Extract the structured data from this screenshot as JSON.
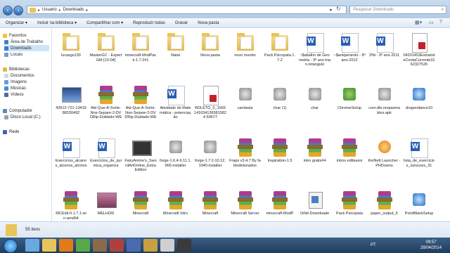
{
  "address": {
    "crumbs": [
      "Usuario",
      "Downloads"
    ],
    "search_placeholder": "Pesquisar Downloads"
  },
  "toolbar": {
    "organize": "Organizar",
    "include": "Incluir na biblioteca",
    "share": "Compartilhar com",
    "play": "Reproduzir todas",
    "burn": "Gravar",
    "new_folder": "Nova pasta"
  },
  "sidebar": {
    "favorites": "Favoritos",
    "desktop": "Área de Trabalho",
    "downloads": "Downloads",
    "places": "Locais",
    "libraries": "Bibliotecas",
    "documents": "Documentos",
    "images": "Imagens",
    "music": "Músicas",
    "videos": "Vídeos",
    "computer": "Computador",
    "disk": "Disco Local (C:)",
    "network": "Rede"
  },
  "files": [
    {
      "name": "lucasgs130",
      "type": "folder"
    },
    {
      "name": "MasterGC - ExpertGM [10-04]",
      "type": "folder"
    },
    {
      "name": "minecraft-ModPack-1.7.2#1",
      "type": "folder"
    },
    {
      "name": "Natal",
      "type": "folder"
    },
    {
      "name": "Nova pasta",
      "type": "folder"
    },
    {
      "name": "novo mundo",
      "type": "folder"
    },
    {
      "name": "Pack Psicopata 1.7.2",
      "type": "folder"
    },
    {
      "name": "~$abalho de Geometria - 9º ano trian.retangulo",
      "type": "doc"
    },
    {
      "name": "~$anejamento - 9ºano-2012",
      "type": "doc"
    },
    {
      "name": "3ºbi - 9º ano 2011",
      "type": "doc"
    },
    {
      "name": "04201453ExtratodeContaCorrente3162327526",
      "type": "pdf"
    },
    {
      "name": "43912-721-1341986530492",
      "type": "img"
    },
    {
      "name": "Até-Que-A-Sorte-Nos-Separe-2-DVDRip-Dublado-WELLINGTON-...",
      "type": "rar"
    },
    {
      "name": "Até-Que-A-Sorte-Nos-Separe-2-DVDRip-Dublado-WELLINGTON-...",
      "type": "rar"
    },
    {
      "name": "Atividade de Matemática - potenciação",
      "type": "doc"
    },
    {
      "name": "BOLETO_0_19031416341365815824 60677",
      "type": "pdf"
    },
    {
      "name": "camtasia",
      "type": "app2"
    },
    {
      "name": "char (1)",
      "type": "app2"
    },
    {
      "name": "char",
      "type": "app2"
    },
    {
      "name": "ChromeSetup",
      "type": "app"
    },
    {
      "name": "com.dle.respawnables.apk",
      "type": "app2"
    },
    {
      "name": "dragondance10",
      "type": "blue"
    },
    {
      "name": "Exercicios_alcanos_alcenos_alcinos",
      "type": "doc"
    },
    {
      "name": "Exercicios_de_quimica_organica",
      "type": "doc"
    },
    {
      "name": "FairyAnime's_SwordArtOnline_ExtraEdition",
      "type": "video"
    },
    {
      "name": "forge-1.6.4-9.11.1.965-installer",
      "type": "app2"
    },
    {
      "name": "forge-1.7.2-10.12.1040-installer",
      "type": "app2"
    },
    {
      "name": "Fraps v3.4.7 By fabiodetonados",
      "type": "rar"
    },
    {
      "name": "Inspiration-1.5",
      "type": "rar"
    },
    {
      "name": "intro gratis#4",
      "type": "rar"
    },
    {
      "name": "intros editaveis",
      "type": "rar"
    },
    {
      "name": "KeiNett Launcher - PHDowns",
      "type": "orange"
    },
    {
      "name": "lista_de_exercicios_solucoes_31",
      "type": "doc"
    },
    {
      "name": "MCEdit-0.1.7.1.win-amd64",
      "type": "rar"
    },
    {
      "name": "MELHOR",
      "type": "imgpink"
    },
    {
      "name": "Minecraft",
      "type": "rar"
    },
    {
      "name": "Minecraft Intro",
      "type": "rar"
    },
    {
      "name": "Minecraft",
      "type": "rar"
    },
    {
      "name": "Minecraft Server",
      "type": "rar"
    },
    {
      "name": "minecraft-ModP",
      "type": "rar"
    },
    {
      "name": "Orbit-Downloade",
      "type": "setup"
    },
    {
      "name": "Pack Psicopata",
      "type": "rar"
    },
    {
      "name": "paper_output_5",
      "type": "rar"
    },
    {
      "name": "PointBlankSetup",
      "type": "blue"
    }
  ],
  "status": {
    "count": "55 itens"
  },
  "taskbar": {
    "lang": "PT",
    "time": "09:57",
    "date": "28/04/2014"
  }
}
